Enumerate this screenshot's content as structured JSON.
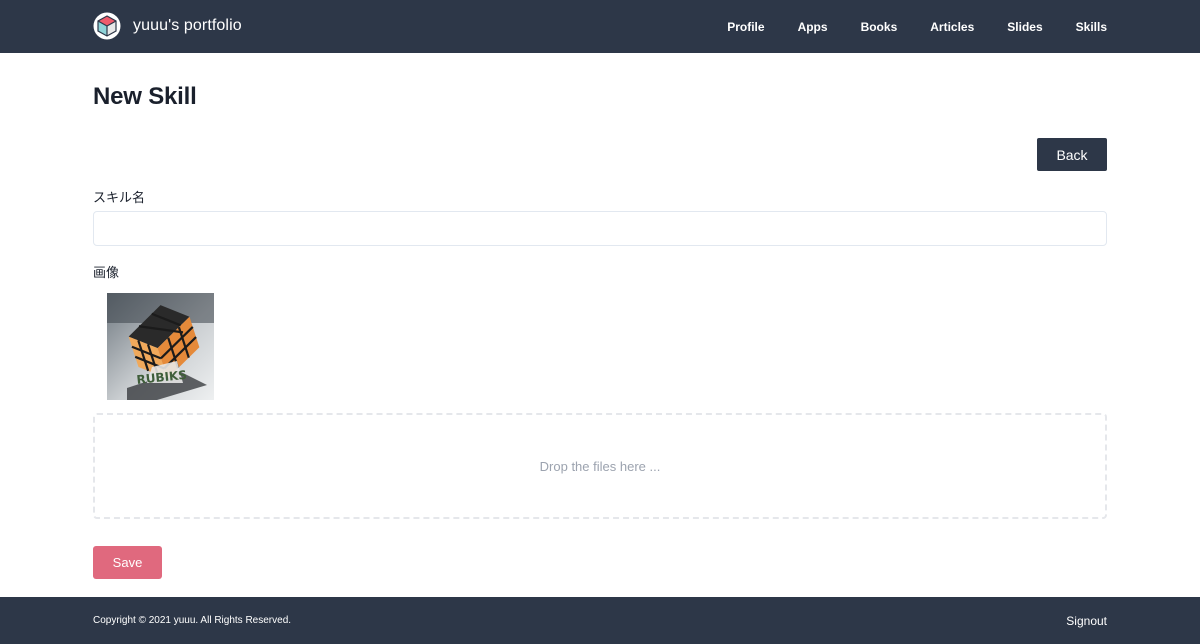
{
  "header": {
    "brand_title": "yuuu's portfolio",
    "logo_icon": "cube-logo-icon",
    "nav": [
      {
        "label": "Profile"
      },
      {
        "label": "Apps"
      },
      {
        "label": "Books"
      },
      {
        "label": "Articles"
      },
      {
        "label": "Slides"
      },
      {
        "label": "Skills"
      }
    ]
  },
  "main": {
    "title": "New Skill",
    "back_label": "Back",
    "name_label": "スキル名",
    "name_value": "",
    "image_label": "画像",
    "image_preview": "rubiks-cube-photo",
    "dropzone_text": "Drop the files here ...",
    "save_label": "Save"
  },
  "footer": {
    "copyright": "Copyright © 2021 yuuu. All Rights Reserved.",
    "signout_label": "Signout"
  },
  "colors": {
    "header_bg": "#2d3748",
    "footer_bg": "#2d3748",
    "save_button": "#e0697e",
    "dropzone_border": "#e5e7eb"
  }
}
